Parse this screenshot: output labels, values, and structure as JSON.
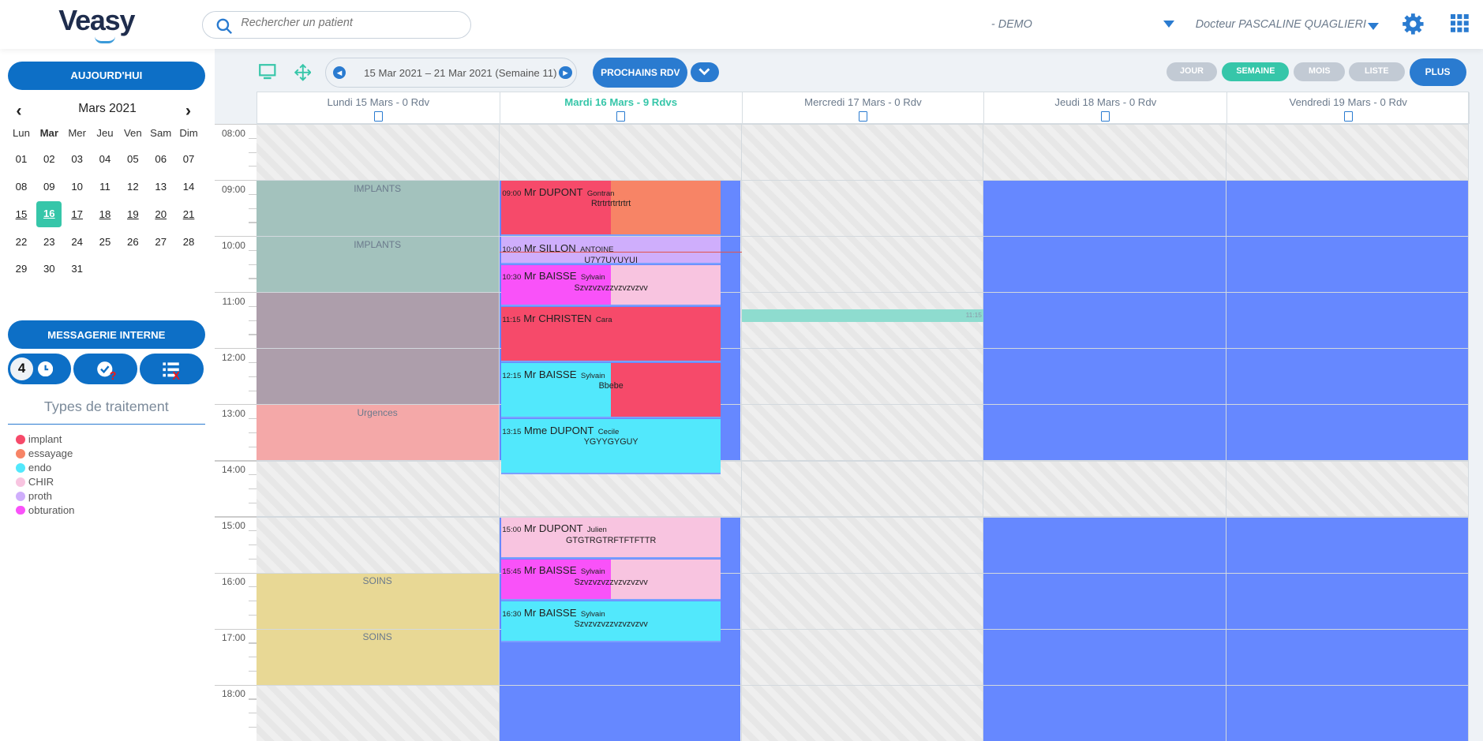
{
  "header": {
    "logo": "Veasy",
    "search_placeholder": "Rechercher un patient",
    "site": "- DEMO",
    "doctor": "Docteur PASCALINE QUAGLIERI"
  },
  "sidebar": {
    "today_label": "AUJOURD'HUI",
    "month_title": "Mars 2021",
    "weekdays": [
      "Lun",
      "Mar",
      "Mer",
      "Jeu",
      "Ven",
      "Sam",
      "Dim"
    ],
    "weeks": [
      [
        "01",
        "02",
        "03",
        "04",
        "05",
        "06",
        "07"
      ],
      [
        "08",
        "09",
        "10",
        "11",
        "12",
        "13",
        "14"
      ],
      [
        "15",
        "16",
        "17",
        "18",
        "19",
        "20",
        "21"
      ],
      [
        "22",
        "23",
        "24",
        "25",
        "26",
        "27",
        "28"
      ],
      [
        "29",
        "30",
        "31"
      ]
    ],
    "selected_day": "16",
    "messaging_label": "MESSAGERIE INTERNE",
    "pending_count": "4",
    "types_title": "Types de traitement",
    "types": [
      {
        "label": "implant",
        "color": "#f64a6a"
      },
      {
        "label": "essayage",
        "color": "#f78466"
      },
      {
        "label": "endo",
        "color": "#52e8fc"
      },
      {
        "label": "CHIR",
        "color": "#f8c4e0"
      },
      {
        "label": "proth",
        "color": "#cfaefc"
      },
      {
        "label": "obturation",
        "color": "#f952f9"
      }
    ]
  },
  "toolbar": {
    "date_range": "15 Mar 2021 – 21 Mar 2021 (Semaine 11)",
    "next_appointments": "PROCHAINS RDV",
    "views": [
      "JOUR",
      "SEMAINE",
      "MOIS",
      "LISTE"
    ],
    "active_view": "SEMAINE",
    "more": "PLUS"
  },
  "days": [
    {
      "label": "Lundi 15 Mars - 0 Rdv",
      "active": false
    },
    {
      "label": "Mardi 16 Mars - 9 Rdvs",
      "active": true
    },
    {
      "label": "Mercredi 17 Mars - 0 Rdv",
      "active": false
    },
    {
      "label": "Jeudi 18 Mars - 0 Rdv",
      "active": false
    },
    {
      "label": "Vendredi 19 Mars - 0 Rdv",
      "active": false
    }
  ],
  "hours": [
    "08:00",
    "09:00",
    "10:00",
    "11:00",
    "12:00",
    "13:00",
    "14:00",
    "15:00",
    "16:00",
    "17:00",
    "18:00"
  ],
  "monday_blocks": [
    {
      "label": "IMPLANTS",
      "start": "09:00",
      "end": "10:00",
      "color": "#a3c2bd"
    },
    {
      "label": "IMPLANTS",
      "start": "10:00",
      "end": "11:00",
      "color": "#a3c2bd"
    },
    {
      "label": "",
      "start": "11:00",
      "end": "13:00",
      "color": "#ad9eab"
    },
    {
      "label": "Urgences",
      "start": "13:00",
      "end": "14:00",
      "color": "#f4a8a8"
    },
    {
      "label": "SOINS",
      "start": "16:00",
      "end": "17:00",
      "color": "#e8d895"
    },
    {
      "label": "SOINS",
      "start": "17:00",
      "end": "18:00",
      "color": "#e8d895"
    }
  ],
  "availability_color": "#6688ff",
  "availability": [
    {
      "start": "09:00",
      "end": "14:00"
    },
    {
      "start": "15:00",
      "end": "19:00"
    }
  ],
  "wednesday_slot": {
    "time": "11:15",
    "color": "#8edccf"
  },
  "now_time": "10:17",
  "appointments": [
    {
      "time": "09:00",
      "name": "Mr DUPONT",
      "first": "Gontran",
      "comment": "Rtrtrtrtrtrtrt",
      "duration_min": 60,
      "colors": [
        "#f64a6a",
        "#f78466"
      ]
    },
    {
      "time": "10:00",
      "name": "Mr SILLON",
      "first": "ANTOINE",
      "comment": "U7Y7UYUYUI",
      "duration_min": 30,
      "colors": [
        "#cfaefc"
      ]
    },
    {
      "time": "10:30",
      "name": "Mr BAISSE",
      "first": "Sylvain",
      "comment": "Szvzvzvzzvzvzvzvv",
      "duration_min": 45,
      "colors": [
        "#f952f9",
        "#f8c4e0"
      ]
    },
    {
      "time": "11:15",
      "name": "Mr CHRISTEN",
      "first": "Cara",
      "comment": "",
      "duration_min": 60,
      "colors": [
        "#f64a6a"
      ]
    },
    {
      "time": "12:15",
      "name": "Mr BAISSE",
      "first": "Sylvain",
      "comment": "Bbebe",
      "duration_min": 60,
      "colors": [
        "#52e8fc",
        "#f64a6a"
      ]
    },
    {
      "time": "13:15",
      "name": "Mme DUPONT",
      "first": "Cecile",
      "comment": "YGYYGYGUY",
      "duration_min": 60,
      "colors": [
        "#52e8fc"
      ]
    },
    {
      "time": "15:00",
      "name": "Mr DUPONT",
      "first": "Julien",
      "comment": "GTGTRGTRFTFTFTTR",
      "duration_min": 45,
      "colors": [
        "#f8c4e0"
      ]
    },
    {
      "time": "15:45",
      "name": "Mr BAISSE",
      "first": "Sylvain",
      "comment": "Szvzvzvzzvzvzvzvv",
      "duration_min": 45,
      "colors": [
        "#f952f9",
        "#f8c4e0"
      ]
    },
    {
      "time": "16:30",
      "name": "Mr BAISSE",
      "first": "Sylvain",
      "comment": "Szvzvzvzzvzvzvzvv",
      "duration_min": 45,
      "colors": [
        "#52e8fc"
      ]
    }
  ]
}
